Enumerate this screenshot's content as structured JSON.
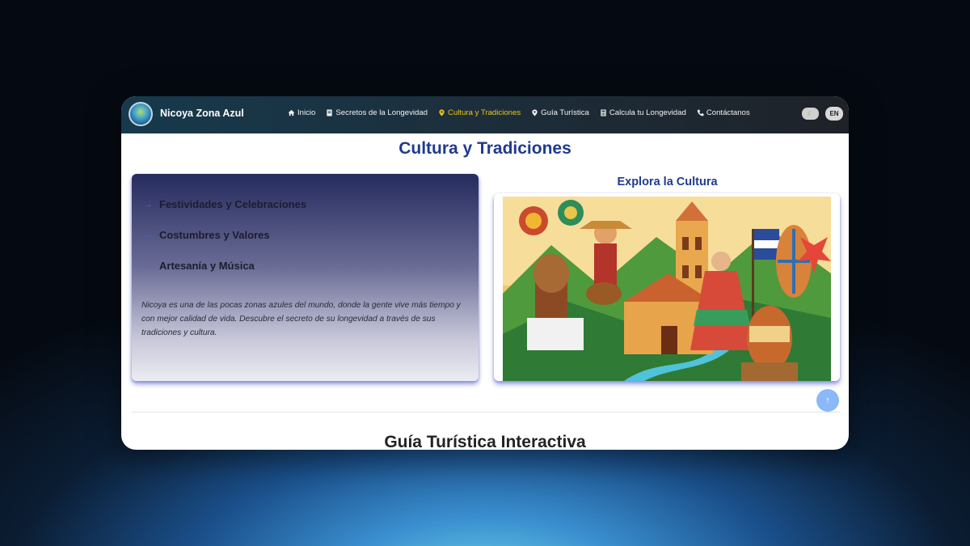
{
  "navbar": {
    "brand": "Nicoya Zona Azul",
    "items": [
      {
        "label": "Inicio",
        "icon": "home-icon",
        "active": false
      },
      {
        "label": "Secretos de la Longevidad",
        "icon": "book-icon",
        "active": false
      },
      {
        "label": "Cultura y Tradiciones",
        "icon": "map-pin-icon",
        "active": true
      },
      {
        "label": "Guía Turística",
        "icon": "map-pin-icon",
        "active": false
      },
      {
        "label": "Calcula tu Longevidad",
        "icon": "calculator-icon",
        "active": false
      },
      {
        "label": "Contáctanos",
        "icon": "phone-icon",
        "active": false
      }
    ],
    "theme_toggle_icon": "moon-icon",
    "language": "EN"
  },
  "section": {
    "title": "Cultura y Tradiciones",
    "list": [
      {
        "label": "Festividades y Celebraciones"
      },
      {
        "label": "Costumbres y Valores"
      },
      {
        "label": "Artesanía y Música"
      }
    ],
    "description": "Nicoya es una de las pocas zonas azules del mundo, donde la gente vive más tiempo y con mejor calidad de vida. Descubre el secreto de su longevidad a través de sus tradiciones y cultura.",
    "explore_title": "Explora la Cultura"
  },
  "next_section": {
    "title": "Guía Turística Interactiva"
  },
  "colors": {
    "accent": "#1f3b8f",
    "nav_active": "#f0c419",
    "arrow": "#3b67e8"
  }
}
